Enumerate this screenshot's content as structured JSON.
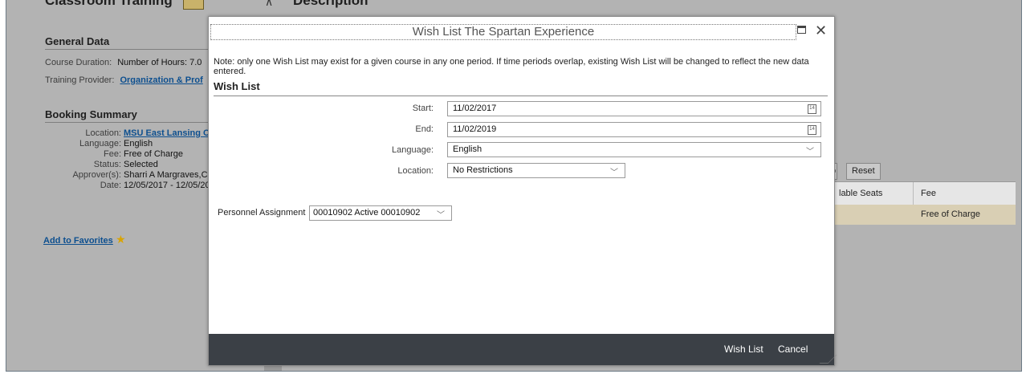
{
  "background": {
    "title": "Classroom Training",
    "description_heading": "Description",
    "general_data": {
      "heading": "General Data",
      "rows": [
        {
          "label": "Course Duration:",
          "value": "Number of Hours: 7.0"
        },
        {
          "label": "Training Provider:",
          "value": "Organization & Prof"
        }
      ]
    },
    "booking_summary": {
      "heading": "Booking Summary",
      "rows": [
        {
          "label": "Location:",
          "value": "MSU East Lansing C"
        },
        {
          "label": "Language:",
          "value": "English"
        },
        {
          "label": "Fee:",
          "value": "Free of Charge"
        },
        {
          "label": "Status:",
          "value": "Selected"
        },
        {
          "label": "Approver(s):",
          "value": "Sharri A Margraves,C"
        },
        {
          "label": "Date:",
          "value": "12/05/2017 - 12/05/20"
        }
      ]
    },
    "add_to_favorites": "Add to Favorites",
    "buttons": {
      "partial": "o",
      "reset": "Reset"
    },
    "table": {
      "columns": [
        "lable Seats",
        "Fee"
      ],
      "row": {
        "fee": "Free of Charge"
      }
    },
    "colors": {
      "selected_row": "#d9cfb4",
      "header_bg": "#e6e6e6"
    }
  },
  "dialog": {
    "title": "Wish List The Spartan Experience",
    "note": "Note: only one Wish List may exist for a given course in any one period. If time periods overlap, existing Wish List will be changed to reflect the new data entered.",
    "section_title": "Wish List",
    "fields": {
      "start": {
        "label": "Start:",
        "value": "11/02/2017"
      },
      "end": {
        "label": "End:",
        "value": "11/02/2019"
      },
      "language": {
        "label": "Language:",
        "value": "English"
      },
      "location": {
        "label": "Location:",
        "value": "No Restrictions"
      }
    },
    "personnel_assignment": {
      "label": "Personnel Assignment",
      "value": "00010902 Active 00010902"
    },
    "footer": {
      "wish_list": "Wish List",
      "cancel": "Cancel"
    },
    "colors": {
      "footer_bg": "#3b4046"
    }
  }
}
